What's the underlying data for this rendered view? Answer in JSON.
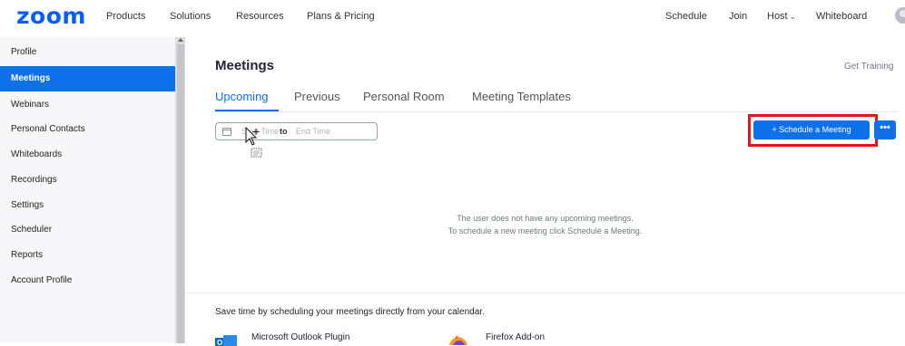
{
  "header": {
    "logo": "zoom",
    "nav_left": [
      "Products",
      "Solutions",
      "Resources",
      "Plans & Pricing"
    ],
    "nav_right": {
      "schedule": "Schedule",
      "join": "Join",
      "host": "Host",
      "whiteboard": "Whiteboard"
    }
  },
  "sidebar": {
    "items": [
      "Profile",
      "Meetings",
      "Webinars",
      "Personal Contacts",
      "Whiteboards",
      "Recordings",
      "Settings",
      "Scheduler",
      "Reports",
      "Account Profile"
    ],
    "active": "Meetings"
  },
  "main": {
    "title": "Meetings",
    "get_training": "Get Training",
    "tabs": [
      "Upcoming",
      "Previous",
      "Personal Room",
      "Meeting Templates"
    ],
    "active_tab": "Upcoming",
    "date_range": {
      "start_placeholder": "Start Time",
      "to_label": "to",
      "end_placeholder": "End Time"
    },
    "schedule_button": "+ Schedule a Meeting",
    "more_button": "•••",
    "empty_line1": "The user does not have any upcoming meetings.",
    "empty_line2": "To schedule a new meeting click Schedule a Meeting.",
    "calendar_promo": "Save time by scheduling your meetings directly from your calendar.",
    "plugins": [
      "Microsoft Outlook Plugin",
      "Firefox Add-on"
    ]
  },
  "colors": {
    "brand": "#0b5cff",
    "accent": "#0e71eb",
    "highlight_box": "#e8121e"
  }
}
